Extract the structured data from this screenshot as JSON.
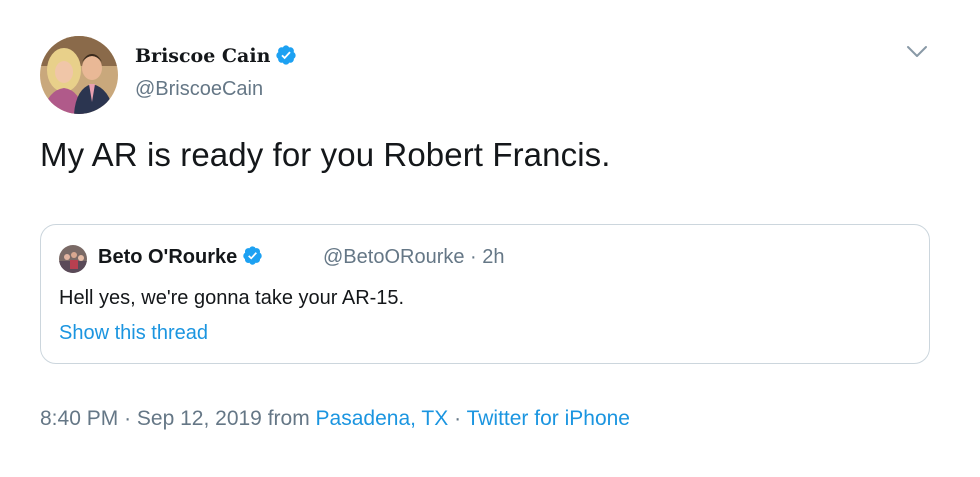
{
  "author": {
    "name": "Briscoe Cain",
    "handle": "@BriscoeCain",
    "verified": true
  },
  "tweet": {
    "text": "My AR is ready for you Robert Francis."
  },
  "quoted_tweet": {
    "name": "Beto O'Rourke",
    "handle": "@BetoORourke",
    "separator": "·",
    "time": "2h",
    "text": "Hell yes, we're gonna take your AR-15.",
    "show_thread_label": "Show this thread"
  },
  "meta": {
    "time": "8:40 PM",
    "sep1": "·",
    "date": "Sep 12, 2019",
    "from_label": "from",
    "location": "Pasadena, TX",
    "sep2": "·",
    "source": "Twitter for iPhone"
  },
  "colors": {
    "link": "#1b95e0",
    "verified_badge": "#1da1f2",
    "secondary_text": "#657786",
    "border": "#ccd6dd"
  },
  "icons": {
    "verified": "verified-badge-icon",
    "menu": "chevron-down-icon"
  }
}
